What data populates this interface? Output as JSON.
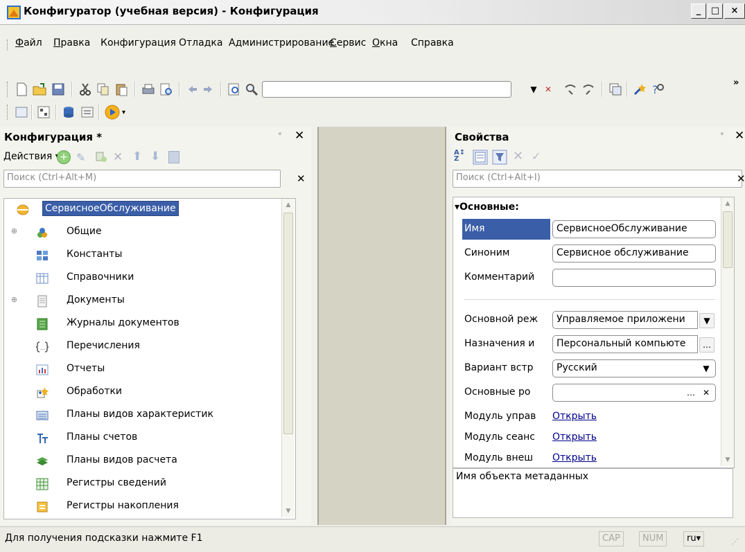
{
  "window": {
    "title": "Конфигуратор (учебная версия) - Конфигурация",
    "controls": [
      "_",
      "□",
      "×"
    ]
  },
  "menu": [
    {
      "label": "Файл",
      "u": "Ф",
      "rest": "айл"
    },
    {
      "label": "Правка",
      "u": "П",
      "rest": "равка"
    },
    {
      "label": "Конфигурация",
      "u": "",
      "rest": "Конфигурация"
    },
    {
      "label": "Отладка",
      "u": "",
      "rest": "Отладка"
    },
    {
      "label": "Администрирование",
      "u": "",
      "rest": "Администрирование"
    },
    {
      "label": "Сервис",
      "u": "С",
      "rest": "ервис"
    },
    {
      "label": "Окна",
      "u": "О",
      "rest": "кна"
    },
    {
      "label": "Справка",
      "u": "",
      "rest": "Справка"
    }
  ],
  "toolbar": {
    "search_value": "",
    "more": "»"
  },
  "config_panel": {
    "title": "Конфигурация *",
    "actions_label": "Действия",
    "search_placeholder": "Поиск (Ctrl+Alt+M)",
    "root": "СервисноеОбслуживание",
    "items": [
      {
        "label": "Общие",
        "icon": "common-icon",
        "expandable": true
      },
      {
        "label": "Константы",
        "icon": "constants-icon",
        "expandable": false
      },
      {
        "label": "Справочники",
        "icon": "catalogs-icon",
        "expandable": false
      },
      {
        "label": "Документы",
        "icon": "documents-icon",
        "expandable": true
      },
      {
        "label": "Журналы документов",
        "icon": "journals-icon",
        "expandable": false
      },
      {
        "label": "Перечисления",
        "icon": "enums-icon",
        "expandable": false
      },
      {
        "label": "Отчеты",
        "icon": "reports-icon",
        "expandable": false
      },
      {
        "label": "Обработки",
        "icon": "dataprocessors-icon",
        "expandable": false
      },
      {
        "label": "Планы видов характеристик",
        "icon": "chart-of-char-icon",
        "expandable": false
      },
      {
        "label": "Планы счетов",
        "icon": "chart-of-accounts-icon",
        "expandable": false
      },
      {
        "label": "Планы видов расчета",
        "icon": "calc-types-icon",
        "expandable": false
      },
      {
        "label": "Регистры сведений",
        "icon": "info-registers-icon",
        "expandable": false
      },
      {
        "label": "Регистры накопления",
        "icon": "accum-registers-icon",
        "expandable": false
      }
    ]
  },
  "props_panel": {
    "title": "Свойства",
    "search_placeholder": "Поиск (Ctrl+Alt+I)",
    "group": "Основные:",
    "rows": [
      {
        "label": "Имя",
        "value": "СервисноеОбслуживание",
        "kind": "field"
      },
      {
        "label": "Синоним",
        "value": "Сервисное обслуживание",
        "kind": "field"
      },
      {
        "label": "Комментарий",
        "value": "",
        "kind": "field"
      },
      {
        "label": "Основной реж",
        "value": "Управляемое приложени",
        "kind": "select"
      },
      {
        "label": "Назначения и",
        "value": "Персональный компьюте",
        "kind": "ellipsis"
      },
      {
        "label": "Вариант встр",
        "value": "Русский",
        "kind": "select"
      },
      {
        "label": "Основные ро",
        "value": "",
        "kind": "ellipsis-clear"
      },
      {
        "label": "Модуль управ",
        "value": "Открыть",
        "kind": "link"
      },
      {
        "label": "Модуль сеанс",
        "value": "Открыть",
        "kind": "link"
      },
      {
        "label": "Модуль внеш",
        "value": "Открыть",
        "kind": "link"
      }
    ],
    "description": "Имя объекта метаданных"
  },
  "status": {
    "hint": "Для получения подсказки нажмите F1",
    "cap": "CAP",
    "num": "NUM",
    "lang": "ru"
  },
  "colors": {
    "selection": "#3a5ea8",
    "link": "#00008b"
  }
}
